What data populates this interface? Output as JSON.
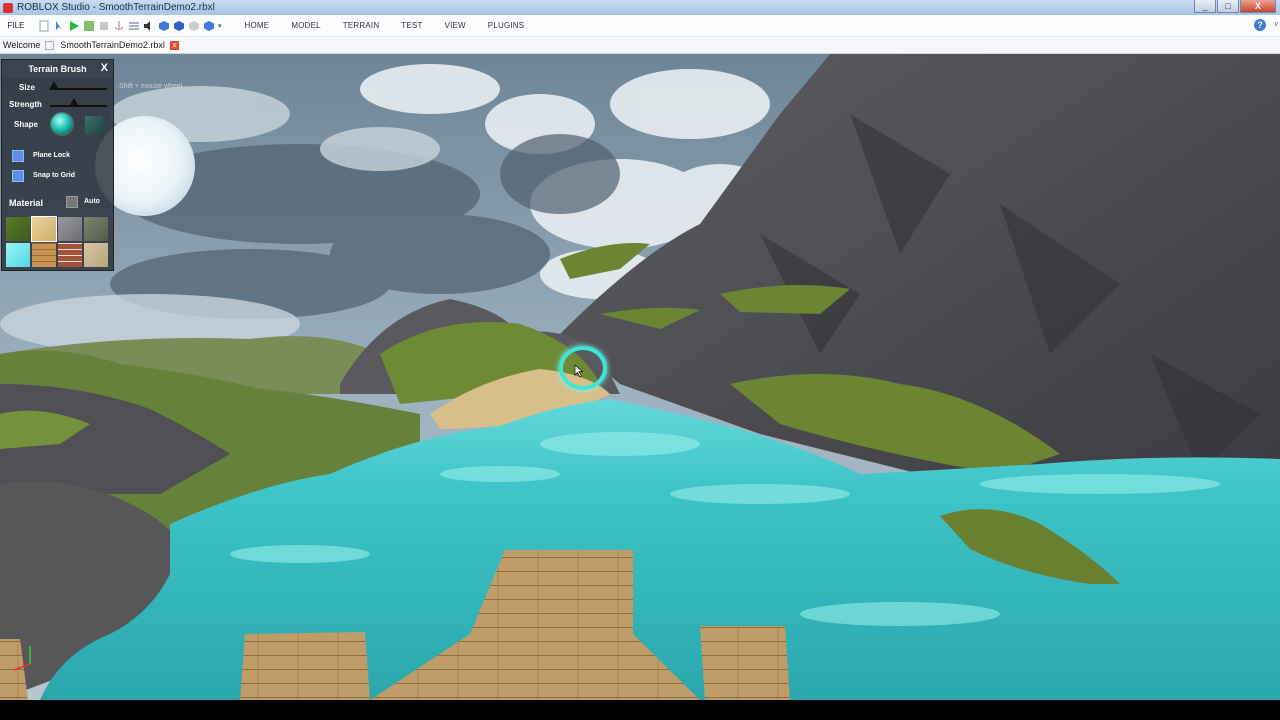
{
  "window": {
    "title": "ROBLOX Studio - SmoothTerrainDemo2.rbxl",
    "minimize": "_",
    "maximize": "□",
    "close": "X"
  },
  "menubar": {
    "file": "FILE",
    "tabs": [
      "HOME",
      "MODEL",
      "TERRAIN",
      "TEST",
      "VIEW",
      "PLUGINS"
    ],
    "help": "?",
    "caret": "v"
  },
  "doctabs": [
    {
      "label": "Welcome"
    },
    {
      "label": "SmoothTerrainDemo2.rbxl",
      "close": "x"
    }
  ],
  "brush_panel": {
    "title": "Terrain Brush",
    "close": "X",
    "hint": "Shift + mouse wheel",
    "size_label": "Size",
    "size_value": 0.08,
    "strength_label": "Strength",
    "strength_value": 0.4,
    "shape_label": "Shape",
    "plane_lock": "Plane Lock",
    "snap_to_grid": "Snap to Grid",
    "material_label": "Material",
    "auto_label": "Auto",
    "materials": [
      "grass",
      "sand",
      "rock",
      "slate",
      "water",
      "wood-planks",
      "brick",
      "sandstone"
    ]
  },
  "colors": {
    "water": "#38c2c4",
    "grass": "#6f8a35",
    "rock": "#4a4a4e",
    "sky": "#8fa4b6",
    "brush": "#3ee6d7"
  }
}
